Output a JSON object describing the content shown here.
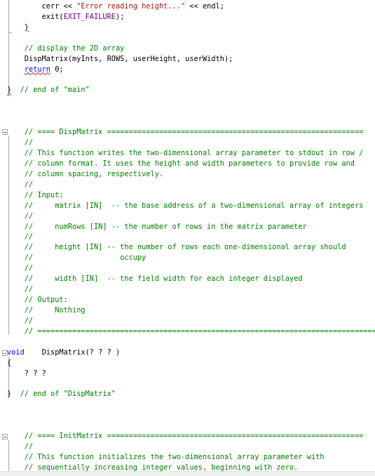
{
  "editor": {
    "colors": {
      "comment": "#008000",
      "string": "#a31515",
      "keyword": "#0000ff",
      "macro": "#6f008a",
      "text": "#000000"
    },
    "lines": [
      [
        {
          "t": "        cerr << ",
          "c": ""
        },
        {
          "t": "\"Error reading height...\"",
          "c": "str"
        },
        {
          "t": " << endl;",
          "c": ""
        }
      ],
      [
        {
          "t": "        exit(",
          "c": ""
        },
        {
          "t": "EXIT_FAILURE",
          "c": "mac"
        },
        {
          "t": ");",
          "c": ""
        }
      ],
      [
        {
          "t": "    ",
          "c": ""
        },
        {
          "t": "}",
          "c": "err"
        }
      ],
      [],
      [
        {
          "t": "    // display the 2D array",
          "c": "cmt"
        }
      ],
      [
        {
          "t": "    DispMatrix(myInts, ROWS, userHeight, userWidth);",
          "c": ""
        }
      ],
      [
        {
          "t": "    ",
          "c": ""
        },
        {
          "t": "return",
          "c": "kw err"
        },
        {
          "t": " 0;",
          "c": ""
        }
      ],
      [],
      [
        {
          "t": "}",
          "c": "err"
        },
        {
          "t": "  // end of \"main\"",
          "c": "cmt"
        }
      ],
      [],
      [],
      [],
      [
        {
          "t": "    // ==== DispMatrix ===========================================================",
          "c": "cmt"
        }
      ],
      [
        {
          "t": "    //",
          "c": "cmt"
        }
      ],
      [
        {
          "t": "    // This function writes the two-dimensional array parameter to stdout in row /",
          "c": "cmt"
        }
      ],
      [
        {
          "t": "    // column format. It uses the height and width parameters to provide row and",
          "c": "cmt"
        }
      ],
      [
        {
          "t": "    // column spacing, respectively.",
          "c": "cmt"
        }
      ],
      [
        {
          "t": "    //",
          "c": "cmt"
        }
      ],
      [
        {
          "t": "    // Input:",
          "c": "cmt"
        }
      ],
      [
        {
          "t": "    //     matrix [IN]  -- the base address of a two-dimensional array of integers",
          "c": "cmt"
        }
      ],
      [
        {
          "t": "    //",
          "c": "cmt"
        }
      ],
      [
        {
          "t": "    //     numRows [IN] -- the number of rows in the matrix parameter",
          "c": "cmt"
        }
      ],
      [
        {
          "t": "    //",
          "c": "cmt"
        }
      ],
      [
        {
          "t": "    //     height [IN] -- the number of rows each one-dimensional array should",
          "c": "cmt"
        }
      ],
      [
        {
          "t": "    //                    occupy",
          "c": "cmt"
        }
      ],
      [
        {
          "t": "    //",
          "c": "cmt"
        }
      ],
      [
        {
          "t": "    //     width [IN]  -- the field width for each integer displayed",
          "c": "cmt"
        }
      ],
      [
        {
          "t": "    //",
          "c": "cmt"
        }
      ],
      [
        {
          "t": "    // Output:",
          "c": "cmt"
        }
      ],
      [
        {
          "t": "    //     Nothing",
          "c": "cmt"
        }
      ],
      [
        {
          "t": "    //",
          "c": "cmt"
        }
      ],
      [
        {
          "t": "    // ==============================================================================",
          "c": "cmt"
        }
      ],
      [],
      [
        {
          "t": "void",
          "c": "kw"
        },
        {
          "t": "    DispMatrix(? ? ? )",
          "c": ""
        }
      ],
      [
        {
          "t": "{",
          "c": ""
        }
      ],
      [
        {
          "t": "    ? ? ?",
          "c": ""
        }
      ],
      [],
      [
        {
          "t": "}",
          "c": ""
        },
        {
          "t": "  // end of \"DispMatrix\"",
          "c": "cmt"
        }
      ],
      [],
      [],
      [],
      [
        {
          "t": "    // ==== InitMatrix ===========================================================",
          "c": "cmt"
        }
      ],
      [
        {
          "t": "    //",
          "c": "cmt"
        }
      ],
      [
        {
          "t": "    // This function initializes the two-dimensional array parameter with",
          "c": "cmt"
        }
      ],
      [
        {
          "t": "    // sequentially increasing integer values, beginning with zero.",
          "c": "cmt"
        }
      ]
    ]
  }
}
